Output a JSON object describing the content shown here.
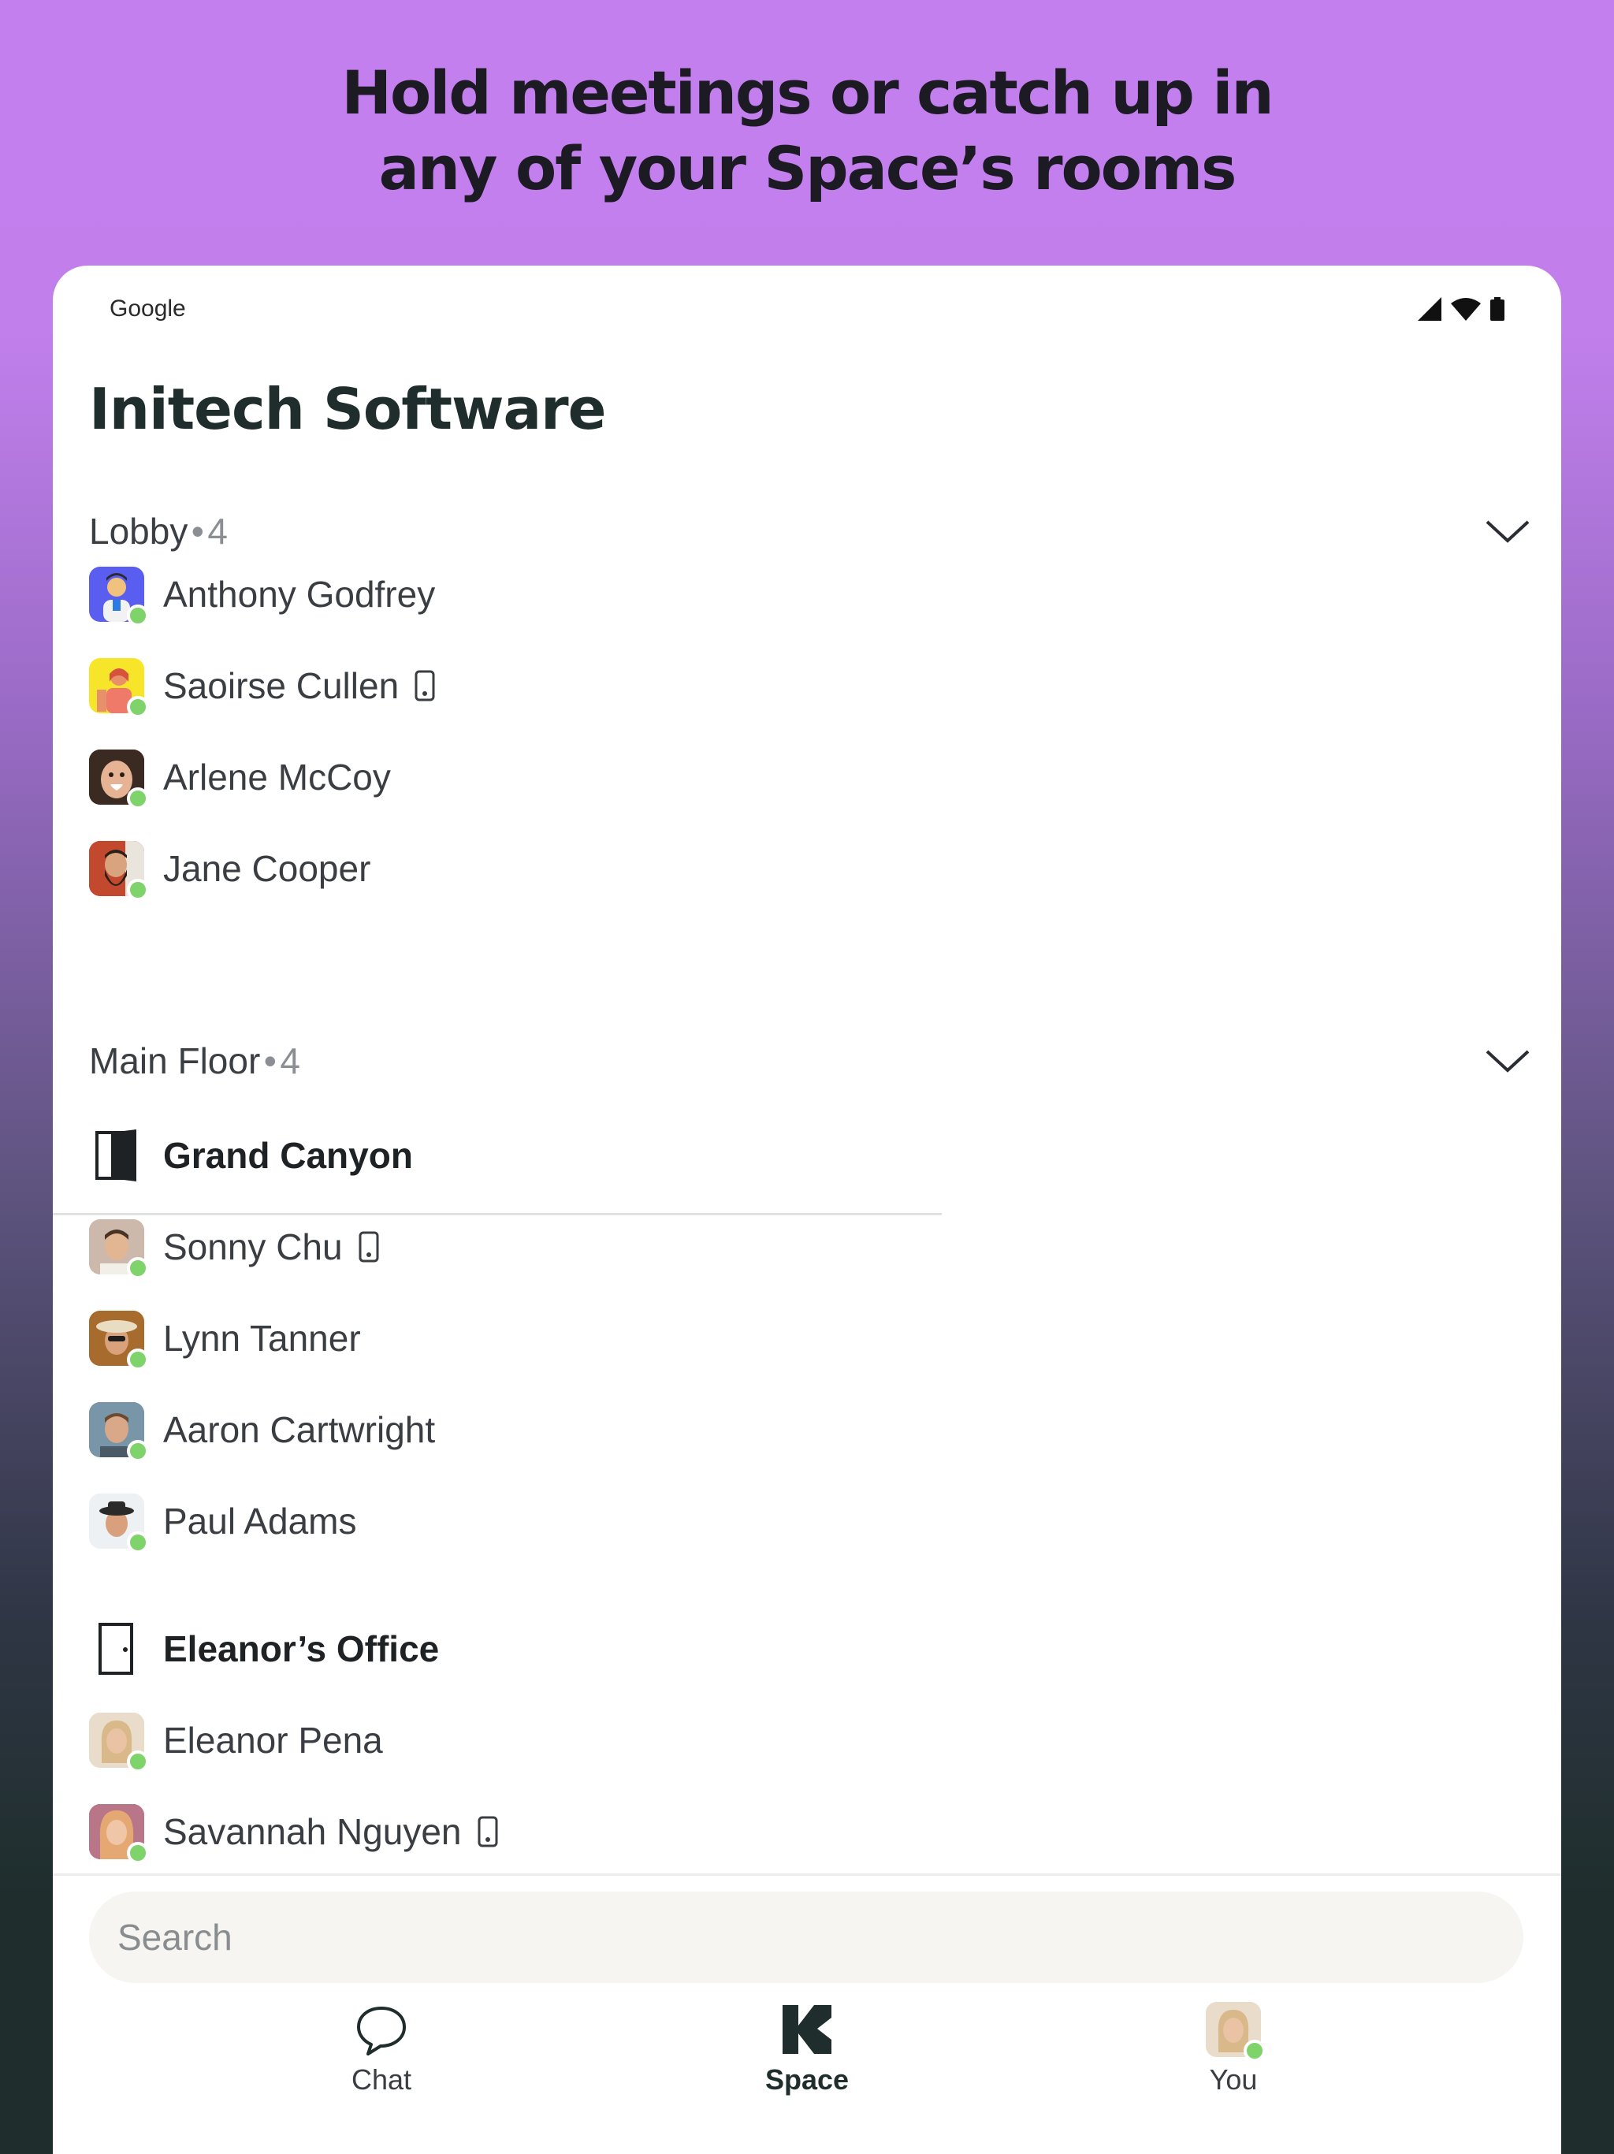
{
  "headline": {
    "line1": "Hold meetings or catch up in",
    "line2": "any of your Space’s rooms"
  },
  "status_bar": {
    "carrier": "Google",
    "icons": [
      "signal-icon",
      "wifi-icon",
      "battery-icon"
    ]
  },
  "app": {
    "title": "Initech Software"
  },
  "lobby": {
    "title": "Lobby",
    "separator": "•",
    "count": "4",
    "members": [
      {
        "name": "Anthony Godfrey",
        "online": true,
        "mobile": false
      },
      {
        "name": "Saoirse Cullen",
        "online": true,
        "mobile": true
      },
      {
        "name": "Arlene McCoy",
        "online": true,
        "mobile": false
      },
      {
        "name": "Jane Cooper",
        "online": true,
        "mobile": false
      }
    ]
  },
  "main_floor": {
    "title": "Main Floor",
    "separator": "•",
    "count": "4",
    "rooms": [
      {
        "name": "Grand Canyon",
        "door": "open",
        "members": [
          {
            "name": "Sonny Chu",
            "online": true,
            "mobile": true
          },
          {
            "name": "Lynn Tanner",
            "online": true,
            "mobile": false
          },
          {
            "name": "Aaron Cartwright",
            "online": true,
            "mobile": false
          },
          {
            "name": "Paul Adams",
            "online": true,
            "mobile": false
          }
        ]
      },
      {
        "name": "Eleanor’s Office",
        "door": "closed",
        "members": [
          {
            "name": "Eleanor Pena",
            "online": true,
            "mobile": false
          },
          {
            "name": "Savannah Nguyen",
            "online": true,
            "mobile": true
          }
        ]
      }
    ]
  },
  "search": {
    "placeholder": "Search"
  },
  "nav": {
    "chat": "Chat",
    "space": "Space",
    "you": "You"
  },
  "colors": {
    "online": "#7ed36b",
    "brand_dark": "#1f2e2d",
    "search_bg": "#f6f5f1"
  }
}
